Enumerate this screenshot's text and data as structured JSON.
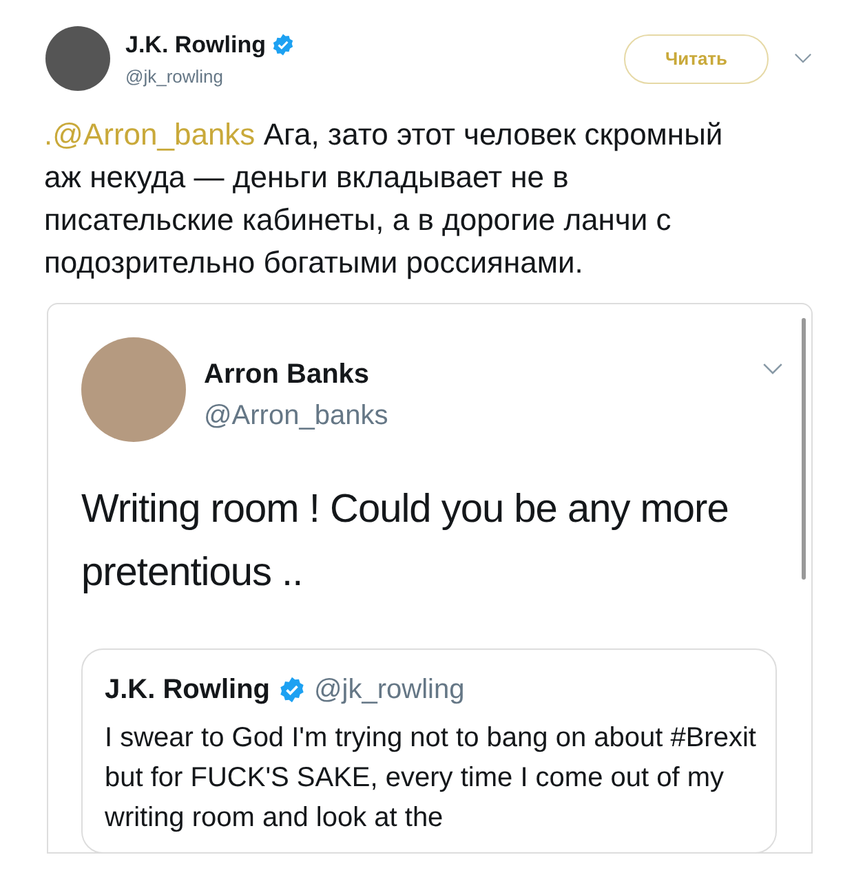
{
  "author": {
    "name": "J.K. Rowling",
    "handle": "@jk_rowling",
    "verified": true
  },
  "follow_button": "Читать",
  "tweet": {
    "mention": ".@Arron_banks",
    "text": "Ага, зато этот человек скромный аж некуда — деньги вкладывает не в писательские кабинеты, а в дорогие ланчи с подозрительно богатыми россиянами."
  },
  "embedded_screenshot": {
    "author": {
      "name": "Arron Banks",
      "handle": "@Arron_banks"
    },
    "text": "Writing room ! Could you be any more pretentious ..",
    "quoted": {
      "name": "J.K. Rowling",
      "verified": true,
      "handle": "@jk_rowling",
      "text": "I swear to God I'm trying not to bang on about #Brexit but for FUCK'S SAKE, every time I come out of my writing room and look at the"
    }
  }
}
